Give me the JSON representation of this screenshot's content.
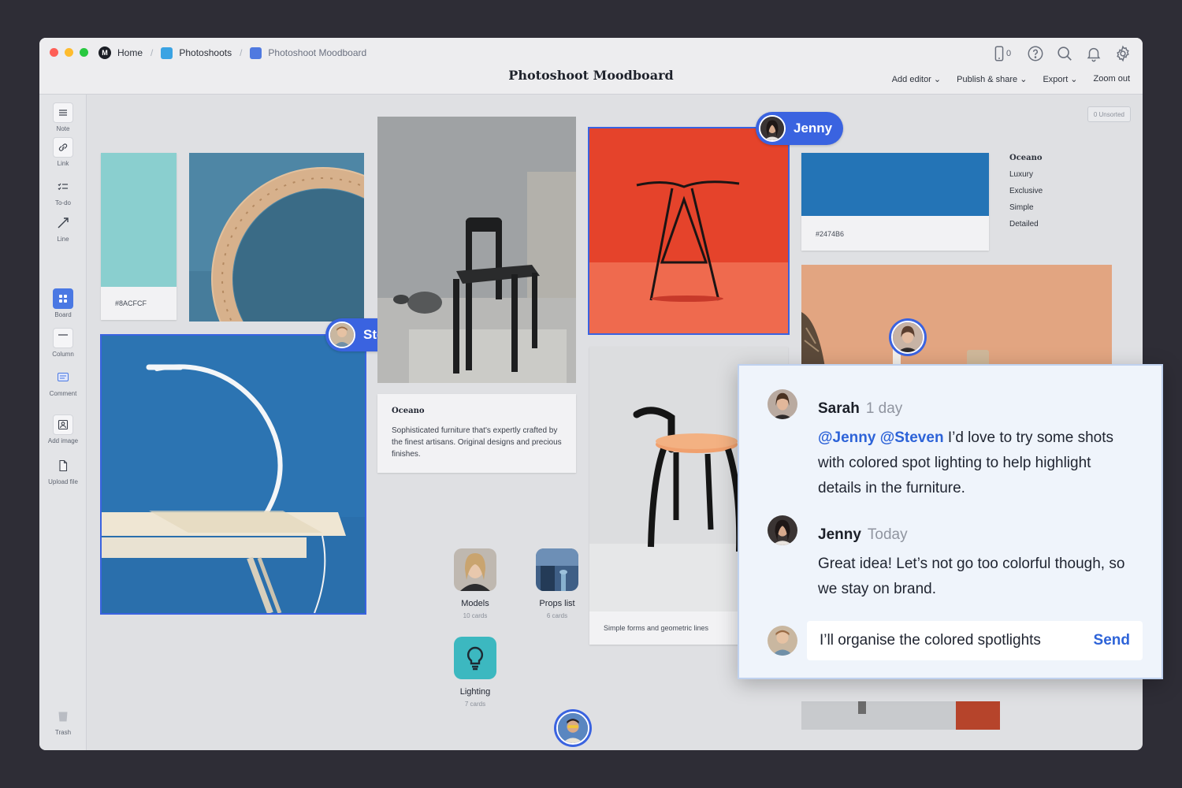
{
  "window": {
    "breadcrumbs": [
      {
        "label": "Home"
      },
      {
        "label": "Photoshoots"
      },
      {
        "label": "Photoshoot Moodboard"
      }
    ],
    "title": "Photoshoot Moodboard",
    "device_count": "0",
    "menu": {
      "add_editor": "Add editor ⌄",
      "publish_share": "Publish & share ⌄",
      "export": "Export ⌄",
      "zoom_out": "Zoom out"
    },
    "icons": [
      "mobile-device-icon",
      "help-icon",
      "search-icon",
      "bell-icon",
      "gear-icon"
    ]
  },
  "sidebar": {
    "tools": [
      {
        "label": "Note",
        "icon": "note-icon"
      },
      {
        "label": "Link",
        "icon": "link-icon"
      },
      {
        "label": "To-do",
        "icon": "todo-icon"
      },
      {
        "label": "Line",
        "icon": "line-icon"
      },
      {
        "label": "Board",
        "icon": "board-icon"
      },
      {
        "label": "Column",
        "icon": "column-icon"
      },
      {
        "label": "Comment",
        "icon": "comment-icon"
      },
      {
        "label": "Add image",
        "icon": "image-icon"
      },
      {
        "label": "Upload file",
        "icon": "file-icon"
      }
    ],
    "trash": "Trash"
  },
  "canvas": {
    "unsorted": "0 Unsorted",
    "swatch_teal": {
      "hex": "#8ACFCF",
      "color": "#8ACFCF"
    },
    "swatch_blue": {
      "hex": "#2474B6",
      "color": "#2474B6"
    },
    "oceano_card": {
      "title": "Oceano",
      "body": "Sophisticated furniture that's expertly crafted by the finest artisans. Original designs and precious finishes."
    },
    "props": {
      "title": "Oceano",
      "items": [
        "Luxury",
        "Exclusive",
        "Simple",
        "Detailed"
      ]
    },
    "chair_caption": "Simple forms and geometric lines",
    "boards": [
      {
        "name": "Models",
        "count": "10 cards"
      },
      {
        "name": "Props list",
        "count": "6 cards"
      },
      {
        "name": "Lighting",
        "count": "7 cards"
      }
    ],
    "badges": {
      "steven": "Steven",
      "jenny": "Jenny"
    }
  },
  "comments": {
    "thread": [
      {
        "author": "Sarah",
        "time": "1 day",
        "mentions": "@Jenny @Steven",
        "text": " I’d love to try some shots with colored spot lighting to help highlight details in the furniture."
      },
      {
        "author": "Jenny",
        "time": "Today",
        "text": "Great idea! Let’s not go too colorful though, so we stay on brand."
      }
    ],
    "reply_value": "I’ll organise the colored spotlights",
    "send_label": "Send"
  },
  "colors": {
    "accent": "#3A63E0",
    "mention": "#2D63D8",
    "stool_red": "#E8452C",
    "wall_blue": "#2B72B0"
  }
}
